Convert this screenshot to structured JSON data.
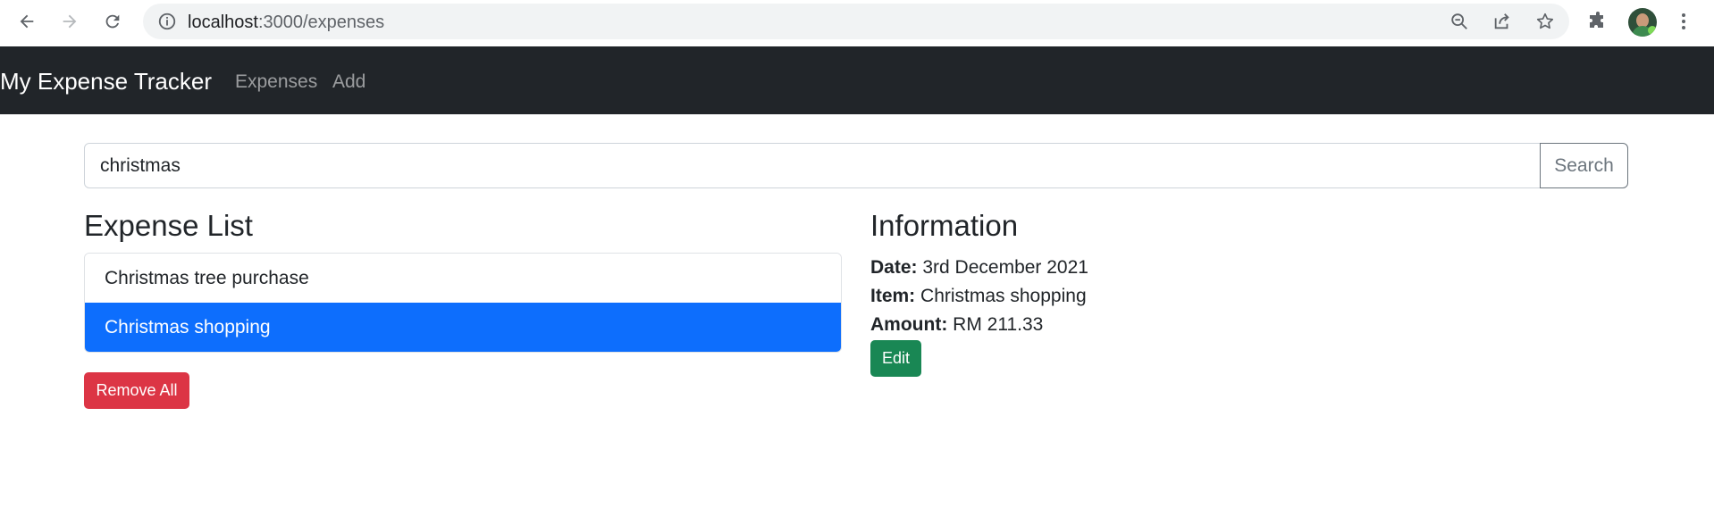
{
  "browser": {
    "url_host": "localhost",
    "url_path": ":3000/expenses",
    "icons": [
      "back-icon",
      "forward-icon",
      "reload-icon",
      "site-info-icon",
      "zoom-out-icon",
      "share-icon",
      "bookmark-star-icon",
      "extensions-icon",
      "profile-avatar",
      "menu-kebab-icon"
    ]
  },
  "navbar": {
    "brand": "My Expense Tracker",
    "links": [
      "Expenses",
      "Add"
    ]
  },
  "search": {
    "value": "christmas",
    "button_label": "Search"
  },
  "expense_list": {
    "heading": "Expense List",
    "items": [
      {
        "label": "Christmas tree purchase",
        "active": false
      },
      {
        "label": "Christmas shopping",
        "active": true
      }
    ],
    "remove_all_label": "Remove All"
  },
  "information": {
    "heading": "Information",
    "date_label": "Date:",
    "date_value": "3rd December 2021",
    "item_label": "Item:",
    "item_value": "Christmas shopping",
    "amount_label": "Amount:",
    "amount_value": "RM 211.33",
    "edit_label": "Edit"
  },
  "colors": {
    "navbar_bg": "#212529",
    "primary": "#0d6efd",
    "danger": "#dc3545",
    "success": "#198754"
  }
}
